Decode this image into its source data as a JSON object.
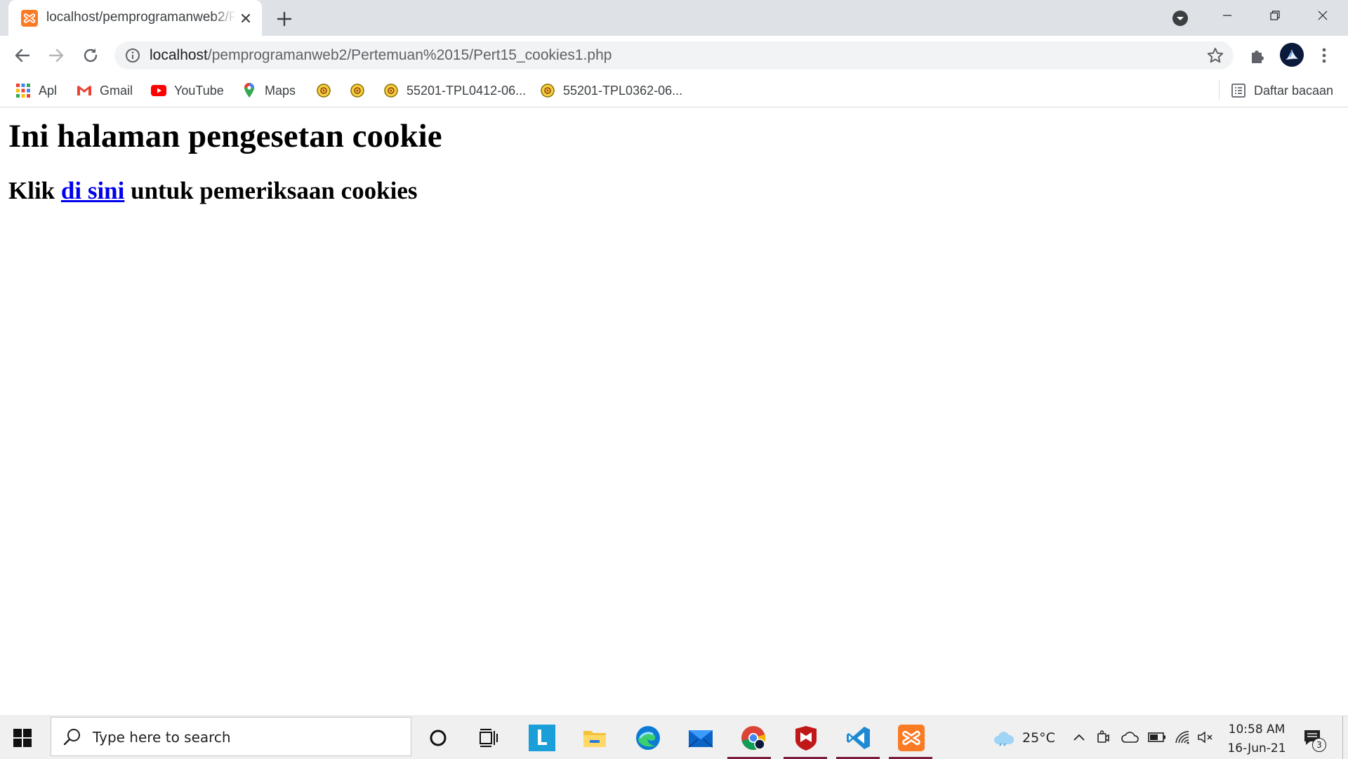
{
  "browser": {
    "tab": {
      "title": "localhost/pemprogramanweb2/Pertemuan%2015/Pert15_cookies1.php"
    },
    "url_host": "localhost",
    "url_path": "/pemprogramanweb2/Pertemuan%2015/Pert15_cookies1.php",
    "bookmarks": [
      {
        "label": "Apl",
        "icon": "apps-grid-icon"
      },
      {
        "label": "Gmail",
        "icon": "gmail-icon"
      },
      {
        "label": "YouTube",
        "icon": "youtube-icon"
      },
      {
        "label": "Maps",
        "icon": "maps-icon"
      },
      {
        "label": "",
        "icon": "site-favicon"
      },
      {
        "label": "",
        "icon": "site-favicon"
      },
      {
        "label": "55201-TPL0412-06...",
        "icon": "site-favicon"
      },
      {
        "label": "55201-TPL0362-06...",
        "icon": "site-favicon"
      }
    ],
    "reading_list": "Daftar bacaan"
  },
  "page": {
    "heading": "Ini halaman pengesetan cookie",
    "line_prefix": "Klik ",
    "link_text": "di sini",
    "line_suffix": " untuk pemeriksaan cookies"
  },
  "taskbar": {
    "search_placeholder": "Type here to search",
    "weather": "25°C",
    "time": "10:58 AM",
    "date": "16-Jun-21",
    "notification_count": "3"
  }
}
